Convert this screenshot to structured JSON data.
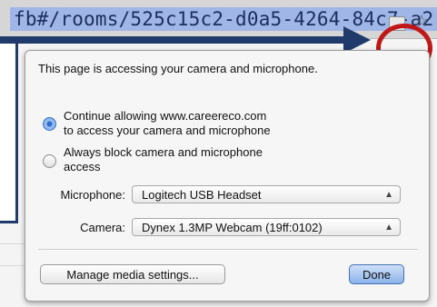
{
  "browser": {
    "url_text": "fb#/rooms/525c15c2-d0a5-4264-84c7-a2",
    "star_icon": "☆"
  },
  "popup": {
    "message": "This page is accessing your camera and microphone.",
    "options": [
      {
        "label_line1": "Continue allowing www.careereco.com",
        "label_line2": "to access your camera and microphone",
        "selected": true
      },
      {
        "label_line1": "Always block camera and microphone",
        "label_line2": "access",
        "selected": false
      }
    ],
    "microphone": {
      "label": "Microphone:",
      "value": "Logitech USB Headset"
    },
    "camera": {
      "label": "Camera:",
      "value": "Dynex 1.3MP Webcam (19ff:0102)"
    },
    "manage_button": "Manage media settings...",
    "done_button": "Done"
  },
  "colors": {
    "accent": "#1f3a6b",
    "highlight": "#c01818",
    "url_selection": "#9fb6e7"
  }
}
